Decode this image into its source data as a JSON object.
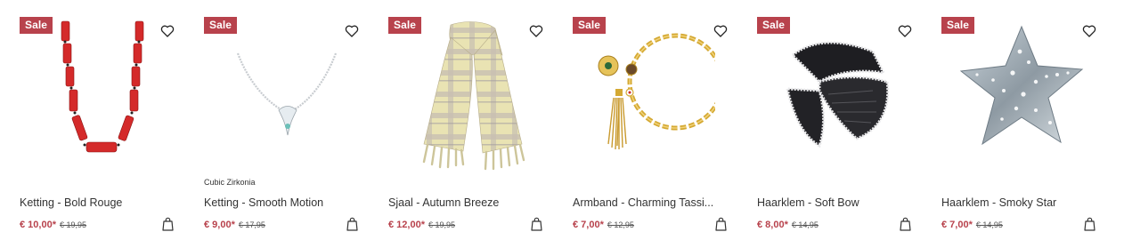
{
  "products": [
    {
      "badge": "Sale",
      "brand": "",
      "title": "Ketting - Bold Rouge",
      "price": "€ 10,00*",
      "old_price": "€ 19,95",
      "wishlist_icon": "heart-outline",
      "cart_icon": "shopping-bag"
    },
    {
      "badge": "Sale",
      "brand": "Cubic Zirkonia",
      "title": "Ketting - Smooth Motion",
      "price": "€ 9,00*",
      "old_price": "€ 17,95",
      "wishlist_icon": "heart-outline",
      "cart_icon": "shopping-bag"
    },
    {
      "badge": "Sale",
      "brand": "",
      "title": "Sjaal - Autumn Breeze",
      "price": "€ 12,00*",
      "old_price": "€ 19,95",
      "wishlist_icon": "heart-outline",
      "cart_icon": "shopping-bag"
    },
    {
      "badge": "Sale",
      "brand": "",
      "title": "Armband - Charming Tassi...",
      "price": "€ 7,00*",
      "old_price": "€ 12,95",
      "wishlist_icon": "heart-outline",
      "cart_icon": "shopping-bag"
    },
    {
      "badge": "Sale",
      "brand": "",
      "title": "Haarklem - Soft Bow",
      "price": "€ 8,00*",
      "old_price": "€ 14,95",
      "wishlist_icon": "heart-outline",
      "cart_icon": "shopping-bag"
    },
    {
      "badge": "Sale",
      "brand": "",
      "title": "Haarklem - Smoky Star",
      "price": "€ 7,00*",
      "old_price": "€ 14,95",
      "wishlist_icon": "heart-outline",
      "cart_icon": "shopping-bag"
    }
  ],
  "colors": {
    "sale": "#b8424c",
    "text": "#333333"
  }
}
